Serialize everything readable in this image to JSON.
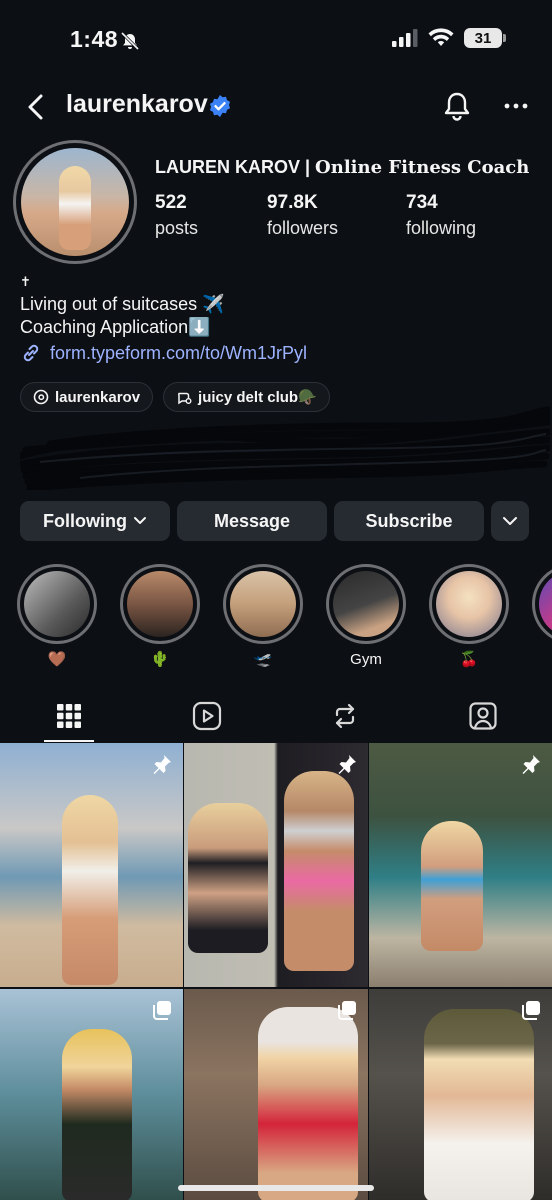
{
  "status": {
    "time": "1:48",
    "battery": "31"
  },
  "header": {
    "username": "laurenkarov"
  },
  "profile": {
    "name_plain": "LAUREN KAROV | ",
    "name_serif": "Online Fitness Coach",
    "stats": [
      {
        "value": "522",
        "label": "posts"
      },
      {
        "value": "97.8K",
        "label": "followers"
      },
      {
        "value": "734",
        "label": "following"
      }
    ],
    "bio_cross": "✝",
    "bio_line1": "Living out of suitcases ✈️",
    "bio_line2": "Coaching Application⬇️",
    "link": "form.typeform.com/to/Wm1JrPyl",
    "chips": [
      {
        "label": "laurenkarov"
      },
      {
        "label": "juicy delt club🪖"
      }
    ]
  },
  "actions": {
    "following": "Following",
    "message": "Message",
    "subscribe": "Subscribe"
  },
  "highlights": [
    {
      "label": "🤎"
    },
    {
      "label": "🌵"
    },
    {
      "label": "🛫"
    },
    {
      "label": "Gym"
    },
    {
      "label": "🍒"
    },
    {
      "label": ""
    }
  ],
  "colors": {
    "background": "#0c0f14",
    "button": "#262a31",
    "link": "#9db3ff",
    "verified": "#3b82f6"
  },
  "icons": [
    "back-arrow",
    "verified-badge",
    "bell",
    "more-dots",
    "grid",
    "reels",
    "reposts",
    "tagged",
    "pin",
    "multi-image"
  ]
}
